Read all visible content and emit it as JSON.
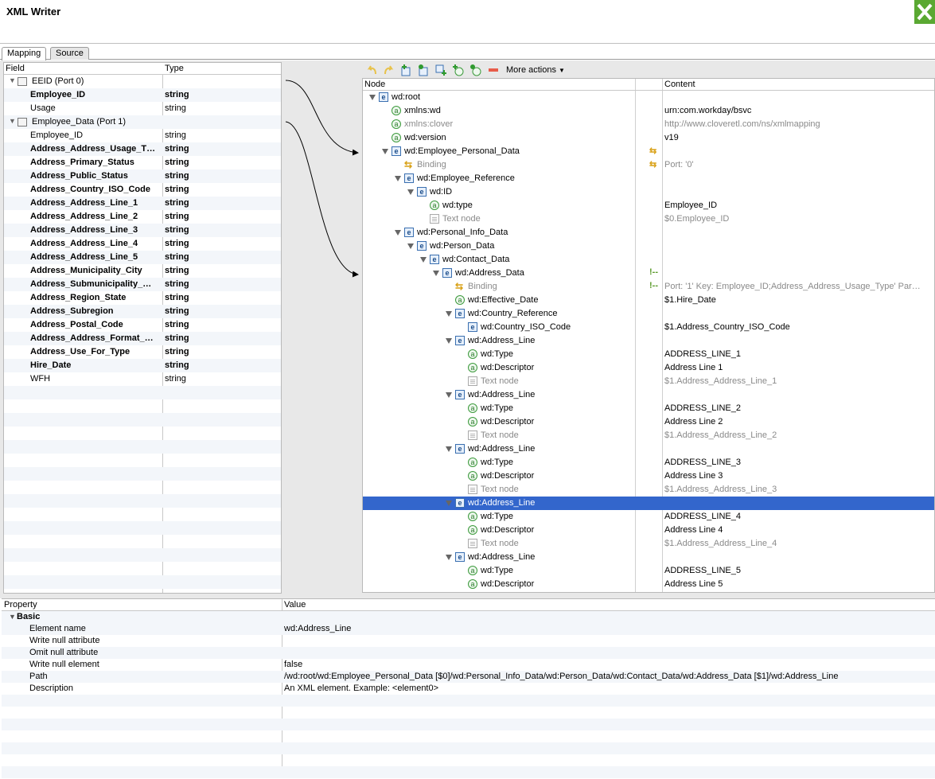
{
  "window": {
    "title": "XML Writer"
  },
  "tabs": [
    {
      "label": "Mapping"
    },
    {
      "label": "Source"
    }
  ],
  "field_table": {
    "headers": {
      "field": "Field",
      "type": "Type"
    },
    "rows": [
      {
        "name": "EEID (Port 0)",
        "type": "",
        "kind": "port"
      },
      {
        "name": "Employee_ID",
        "type": "string",
        "kind": "bold"
      },
      {
        "name": "Usage",
        "type": "string",
        "kind": "normal"
      },
      {
        "name": "Employee_Data (Port 1)",
        "type": "",
        "kind": "port"
      },
      {
        "name": "Employee_ID",
        "type": "string",
        "kind": "normal"
      },
      {
        "name": "Address_Address_Usage_T…",
        "type": "string",
        "kind": "bold"
      },
      {
        "name": "Address_Primary_Status",
        "type": "string",
        "kind": "bold"
      },
      {
        "name": "Address_Public_Status",
        "type": "string",
        "kind": "bold"
      },
      {
        "name": "Address_Country_ISO_Code",
        "type": "string",
        "kind": "bold"
      },
      {
        "name": "Address_Address_Line_1",
        "type": "string",
        "kind": "bold"
      },
      {
        "name": "Address_Address_Line_2",
        "type": "string",
        "kind": "bold"
      },
      {
        "name": "Address_Address_Line_3",
        "type": "string",
        "kind": "bold"
      },
      {
        "name": "Address_Address_Line_4",
        "type": "string",
        "kind": "bold"
      },
      {
        "name": "Address_Address_Line_5",
        "type": "string",
        "kind": "bold"
      },
      {
        "name": "Address_Municipality_City",
        "type": "string",
        "kind": "bold"
      },
      {
        "name": "Address_Submunicipality_…",
        "type": "string",
        "kind": "bold"
      },
      {
        "name": "Address_Region_State",
        "type": "string",
        "kind": "bold"
      },
      {
        "name": "Address_Subregion",
        "type": "string",
        "kind": "bold"
      },
      {
        "name": "Address_Postal_Code",
        "type": "string",
        "kind": "bold"
      },
      {
        "name": "Address_Address_Format_…",
        "type": "string",
        "kind": "bold"
      },
      {
        "name": "Address_Use_For_Type",
        "type": "string",
        "kind": "bold"
      },
      {
        "name": "Hire_Date",
        "type": "string",
        "kind": "bold"
      },
      {
        "name": "WFH",
        "type": "string",
        "kind": "normal"
      }
    ]
  },
  "toolbar": {
    "more_actions": "More actions"
  },
  "tree": {
    "headers": {
      "node": "Node",
      "content": "Content"
    },
    "rows": [
      {
        "label": "wd:root",
        "content": "",
        "icon": "e",
        "depth": 0,
        "twisty": true
      },
      {
        "label": "xmlns:wd",
        "content": "urn:com.workday/bsvc",
        "icon": "a",
        "depth": 1,
        "twisty": false
      },
      {
        "label": "xmlns:clover",
        "content": "http://www.cloveretl.com/ns/xmlmapping",
        "icon": "a",
        "depth": 1,
        "twisty": false,
        "grey": true
      },
      {
        "label": "wd:version",
        "content": "v19",
        "icon": "a",
        "depth": 1,
        "twisty": false
      },
      {
        "label": "wd:Employee_Personal_Data",
        "content": "",
        "icon": "e",
        "depth": 1,
        "twisty": true,
        "marker": "⇆"
      },
      {
        "label": "Binding",
        "content": "Port: '0'",
        "icon": "b",
        "depth": 2,
        "twisty": false,
        "grey": true,
        "marker": "⇆"
      },
      {
        "label": "wd:Employee_Reference",
        "content": "",
        "icon": "e",
        "depth": 2,
        "twisty": true
      },
      {
        "label": "wd:ID",
        "content": "",
        "icon": "e",
        "depth": 3,
        "twisty": true
      },
      {
        "label": "wd:type",
        "content": "Employee_ID",
        "icon": "a",
        "depth": 4,
        "twisty": false
      },
      {
        "label": "Text node",
        "content": "$0.Employee_ID",
        "icon": "t",
        "depth": 4,
        "twisty": false,
        "grey": true
      },
      {
        "label": "wd:Personal_Info_Data",
        "content": "",
        "icon": "e",
        "depth": 2,
        "twisty": true
      },
      {
        "label": "wd:Person_Data",
        "content": "",
        "icon": "e",
        "depth": 3,
        "twisty": true
      },
      {
        "label": "wd:Contact_Data",
        "content": "",
        "icon": "e",
        "depth": 4,
        "twisty": true
      },
      {
        "label": "wd:Address_Data",
        "content": "",
        "icon": "e",
        "depth": 5,
        "twisty": true,
        "marker": "!--"
      },
      {
        "label": "Binding",
        "content": "Port: '1' Key: Employee_ID;Address_Address_Usage_Type' Par…",
        "icon": "b",
        "depth": 6,
        "twisty": false,
        "grey": true,
        "marker": "!--"
      },
      {
        "label": "wd:Effective_Date",
        "content": "$1.Hire_Date",
        "icon": "a",
        "depth": 6,
        "twisty": false
      },
      {
        "label": "wd:Country_Reference",
        "content": "",
        "icon": "e",
        "depth": 6,
        "twisty": true
      },
      {
        "label": "wd:Country_ISO_Code",
        "content": "$1.Address_Country_ISO_Code",
        "icon": "e",
        "depth": 7,
        "twisty": false
      },
      {
        "label": "wd:Address_Line",
        "content": "",
        "icon": "e",
        "depth": 6,
        "twisty": true
      },
      {
        "label": "wd:Type",
        "content": "ADDRESS_LINE_1",
        "icon": "a",
        "depth": 7,
        "twisty": false
      },
      {
        "label": "wd:Descriptor",
        "content": "Address Line 1",
        "icon": "a",
        "depth": 7,
        "twisty": false
      },
      {
        "label": "Text node",
        "content": "$1.Address_Address_Line_1",
        "icon": "t",
        "depth": 7,
        "twisty": false,
        "grey": true
      },
      {
        "label": "wd:Address_Line",
        "content": "",
        "icon": "e",
        "depth": 6,
        "twisty": true
      },
      {
        "label": "wd:Type",
        "content": "ADDRESS_LINE_2",
        "icon": "a",
        "depth": 7,
        "twisty": false
      },
      {
        "label": "wd:Descriptor",
        "content": "Address Line 2",
        "icon": "a",
        "depth": 7,
        "twisty": false
      },
      {
        "label": "Text node",
        "content": "$1.Address_Address_Line_2",
        "icon": "t",
        "depth": 7,
        "twisty": false,
        "grey": true
      },
      {
        "label": "wd:Address_Line",
        "content": "",
        "icon": "e",
        "depth": 6,
        "twisty": true
      },
      {
        "label": "wd:Type",
        "content": "ADDRESS_LINE_3",
        "icon": "a",
        "depth": 7,
        "twisty": false
      },
      {
        "label": "wd:Descriptor",
        "content": "Address Line 3",
        "icon": "a",
        "depth": 7,
        "twisty": false
      },
      {
        "label": "Text node",
        "content": "$1.Address_Address_Line_3",
        "icon": "t",
        "depth": 7,
        "twisty": false,
        "grey": true
      },
      {
        "label": "wd:Address_Line",
        "content": "",
        "icon": "e",
        "depth": 6,
        "twisty": true,
        "selected": true
      },
      {
        "label": "wd:Type",
        "content": "ADDRESS_LINE_4",
        "icon": "a",
        "depth": 7,
        "twisty": false
      },
      {
        "label": "wd:Descriptor",
        "content": "Address Line 4",
        "icon": "a",
        "depth": 7,
        "twisty": false
      },
      {
        "label": "Text node",
        "content": "$1.Address_Address_Line_4",
        "icon": "t",
        "depth": 7,
        "twisty": false,
        "grey": true
      },
      {
        "label": "wd:Address_Line",
        "content": "",
        "icon": "e",
        "depth": 6,
        "twisty": true
      },
      {
        "label": "wd:Type",
        "content": "ADDRESS_LINE_5",
        "icon": "a",
        "depth": 7,
        "twisty": false
      },
      {
        "label": "wd:Descriptor",
        "content": "Address Line 5",
        "icon": "a",
        "depth": 7,
        "twisty": false
      }
    ]
  },
  "properties": {
    "headers": {
      "property": "Property",
      "value": "Value"
    },
    "group": "Basic",
    "rows": [
      {
        "key": "Element name",
        "value": "wd:Address_Line"
      },
      {
        "key": "Write null attribute",
        "value": ""
      },
      {
        "key": "Omit null attribute",
        "value": ""
      },
      {
        "key": "Write null element",
        "value": "false"
      },
      {
        "key": "Path",
        "value": "/wd:root/wd:Employee_Personal_Data [$0]/wd:Personal_Info_Data/wd:Person_Data/wd:Contact_Data/wd:Address_Data [$1]/wd:Address_Line"
      },
      {
        "key": "Description",
        "value": "An XML element. Example: <element0>"
      }
    ]
  }
}
